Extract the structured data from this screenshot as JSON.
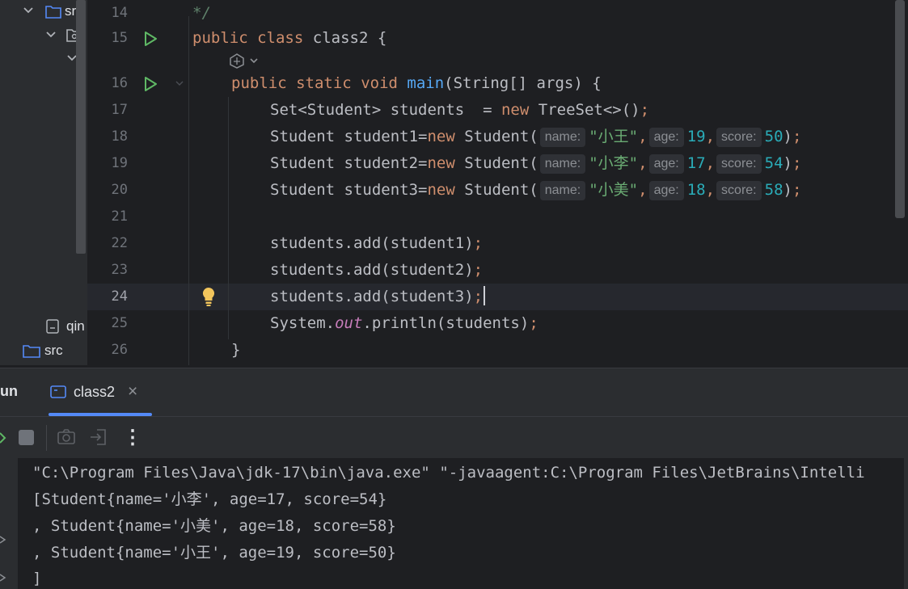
{
  "project_tree": {
    "items": [
      {
        "label": "src",
        "icon": "folder-icon"
      },
      {
        "label": "",
        "icon": "package-icon"
      },
      {
        "label": "qin",
        "icon": "file-icon"
      },
      {
        "label": "src",
        "icon": "folder-icon"
      }
    ]
  },
  "editor": {
    "line_numbers": [
      "14",
      "15",
      "16",
      "17",
      "18",
      "19",
      "20",
      "21",
      "22",
      "23",
      "24",
      "25",
      "26"
    ],
    "current_line": "24",
    "lines": {
      "l14": {
        "comment": "*/"
      },
      "l15": {
        "kw1": "public",
        "kw2": "class",
        "name": "class2",
        "brace": "{"
      },
      "l16": {
        "kw1": "public",
        "kw2": "static",
        "kw3": "void",
        "fn": "main",
        "params": "(String[] args)",
        "brace": "{"
      },
      "l17": {
        "text": "Set<Student> students  = ",
        "kw": "new",
        "rest": " TreeSet<>()",
        "semi": ";"
      },
      "l18": {
        "a": "Student student1=",
        "kw": "new",
        "b": " Student(",
        "h1": "name:",
        "s": "\"小王\"",
        "c1": ",",
        "h2": "age:",
        "n1": "19",
        "c2": ",",
        "h3": "score:",
        "n2": "50",
        "end": ")",
        "semi": ";"
      },
      "l19": {
        "a": "Student student2=",
        "kw": "new",
        "b": " Student(",
        "h1": "name:",
        "s": "\"小李\"",
        "c1": ",",
        "h2": "age:",
        "n1": "17",
        "c2": ",",
        "h3": "score:",
        "n2": "54",
        "end": ")",
        "semi": ";"
      },
      "l20": {
        "a": "Student student3=",
        "kw": "new",
        "b": " Student(",
        "h1": "name:",
        "s": "\"小美\"",
        "c1": ",",
        "h2": "age:",
        "n1": "18",
        "c2": ",",
        "h3": "score:",
        "n2": "58",
        "end": ")",
        "semi": ";"
      },
      "l22": {
        "text": "students.add(student1)",
        "semi": ";"
      },
      "l23": {
        "text": "students.add(student2)",
        "semi": ";"
      },
      "l24": {
        "text": "students.add(student3)",
        "semi": ";"
      },
      "l25": {
        "a": "System.",
        "field": "out",
        "b": ".println(students)",
        "semi": ";"
      },
      "l26": {
        "brace": "}"
      }
    }
  },
  "run_panel": {
    "title": "un",
    "tab_label": "class2",
    "close_glyph": "×",
    "more_glyph": "⋮"
  },
  "console": {
    "lines": [
      "\"C:\\Program Files\\Java\\jdk-17\\bin\\java.exe\" \"-javaagent:C:\\Program Files\\JetBrains\\Intelli",
      "[Student{name='小李', age=17, score=54}",
      ", Student{name='小美', age=18, score=58}",
      ", Student{name='小王', age=19, score=50}",
      "]"
    ]
  },
  "colors": {
    "background": "#1e1f22",
    "panel": "#2b2d30",
    "keyword": "#cf8e6d",
    "function": "#56a8f5",
    "string": "#6aab73",
    "number": "#2aacb8",
    "run_green": "#5fb865"
  }
}
